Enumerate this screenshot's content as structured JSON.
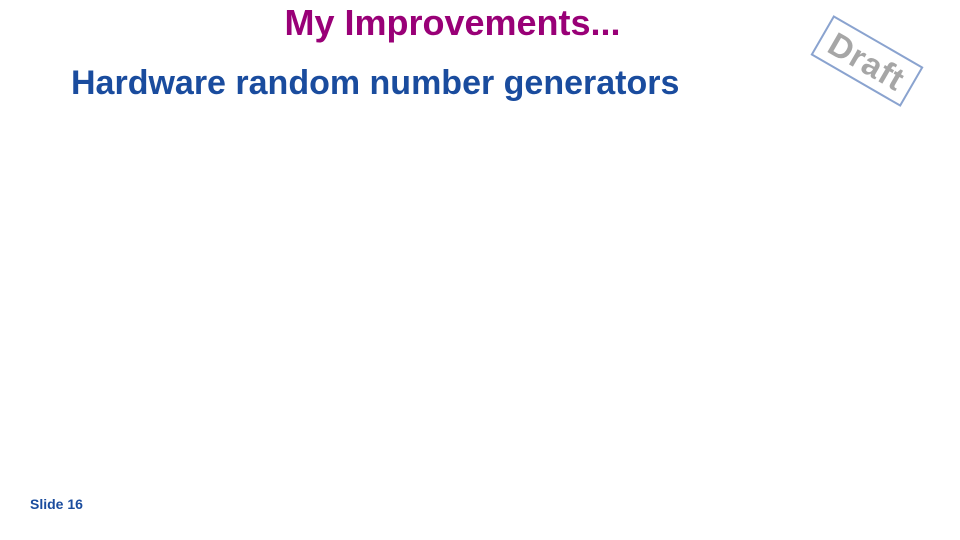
{
  "slide": {
    "title": "My Improvements...",
    "subtitle": "Hardware random number generators",
    "stamp": "Draft",
    "number_label": "Slide 16"
  },
  "colors": {
    "title": "#990077",
    "subtitle": "#1a4c9e",
    "stamp_text": "#a6a6a6",
    "stamp_border": "#8aa3cf"
  }
}
